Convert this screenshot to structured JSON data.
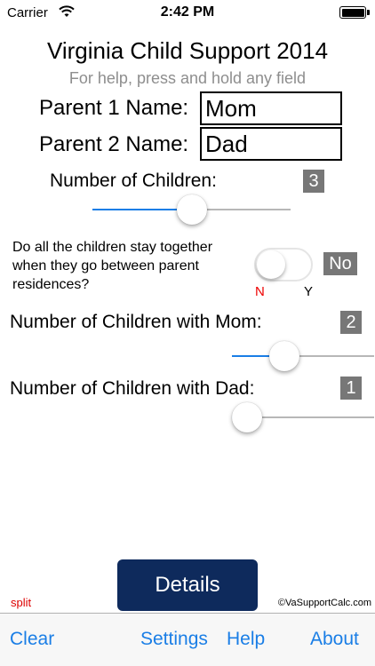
{
  "status_bar": {
    "carrier": "Carrier",
    "time": "2:42 PM"
  },
  "header": {
    "title": "Virginia Child Support 2014",
    "subtitle": "For help, press and hold any field"
  },
  "parent1": {
    "label": "Parent 1 Name:",
    "value": "Mom"
  },
  "parent2": {
    "label": "Parent 2 Name:",
    "value": "Dad"
  },
  "children": {
    "label": "Number of Children:",
    "count": "3",
    "slider_fraction": 0.5
  },
  "together": {
    "question": "Do all the children stay together when they go between parent residences?",
    "answer": "No",
    "no_label": "N",
    "yes_label": "Y",
    "toggle_on": false
  },
  "with_mom": {
    "label": "Number of Children with Mom:",
    "count": "2",
    "slider_fraction": 0.33
  },
  "with_dad": {
    "label": "Number of Children with Dad:",
    "count": "1",
    "slider_fraction": 0.0
  },
  "details_button": "Details",
  "split_label": "split",
  "copyright": "©VaSupportCalc.com",
  "toolbar": {
    "clear": "Clear",
    "settings": "Settings",
    "help": "Help",
    "about": "About"
  },
  "colors": {
    "accent": "#1a7ee6",
    "button": "#0e2a5c",
    "badge": "#777777",
    "no_label": "#e00000"
  }
}
